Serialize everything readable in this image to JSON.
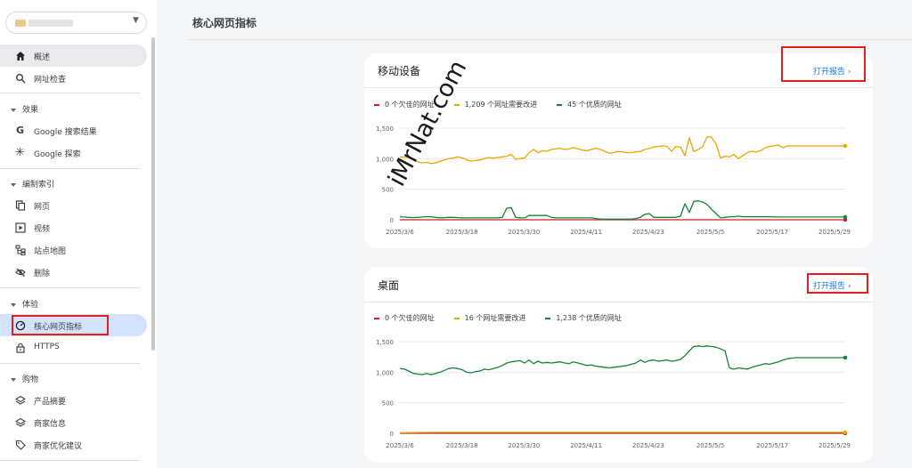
{
  "page_title": "核心网页指标",
  "sidebar": {
    "nav": [
      {
        "key": "overview",
        "label": "概述",
        "icon": "home-icon"
      },
      {
        "key": "url-inspection",
        "label": "网址检查",
        "icon": "search-icon"
      }
    ],
    "sections": [
      {
        "key": "performance",
        "label": "效果",
        "items": [
          {
            "key": "google-search",
            "label": "Google 搜索结果",
            "icon": "google-g-icon"
          },
          {
            "key": "google-discover",
            "label": "Google 探索",
            "icon": "asterisk-icon"
          }
        ]
      },
      {
        "key": "indexing",
        "label": "编制索引",
        "items": [
          {
            "key": "pages",
            "label": "网页",
            "icon": "pages-icon"
          },
          {
            "key": "videos",
            "label": "视频",
            "icon": "video-icon"
          },
          {
            "key": "sitemaps",
            "label": "站点地图",
            "icon": "sitemap-icon"
          },
          {
            "key": "removals",
            "label": "删除",
            "icon": "eye-off-icon"
          }
        ]
      },
      {
        "key": "experience",
        "label": "体验",
        "items": [
          {
            "key": "core-web-vitals",
            "label": "核心网页指标",
            "icon": "speedometer-icon"
          },
          {
            "key": "https",
            "label": "HTTPS",
            "icon": "lock-icon"
          }
        ]
      },
      {
        "key": "shopping",
        "label": "购物",
        "items": [
          {
            "key": "product-snippets",
            "label": "产品摘要",
            "icon": "layers-icon"
          },
          {
            "key": "merchant-listings",
            "label": "商家信息",
            "icon": "layers-icon"
          },
          {
            "key": "merchant-opportunities",
            "label": "商家优化建议",
            "icon": "tag-icon"
          }
        ]
      }
    ]
  },
  "mobile": {
    "title": "移动设备",
    "open_report": "打开报告",
    "legend": [
      {
        "label": "0 个欠佳的网址",
        "color": "#c5221f"
      },
      {
        "label": "1,209 个网址需要改进",
        "color": "#e8a600"
      },
      {
        "label": "45 个优质的网址",
        "color": "#188038"
      }
    ]
  },
  "desktop": {
    "title": "桌面",
    "open_report": "打开报告",
    "legend": [
      {
        "label": "0 个欠佳的网址",
        "color": "#c5221f"
      },
      {
        "label": "16 个网址需要改进",
        "color": "#e8a600"
      },
      {
        "label": "1,238 个优质的网址",
        "color": "#188038"
      }
    ]
  },
  "watermark": "iMrNat.com",
  "chart_data": [
    {
      "type": "line",
      "title": "移动设备",
      "x": [
        "2025/3/6",
        "2025/3/18",
        "2025/3/30",
        "2025/4/11",
        "2025/4/23",
        "2025/5/5",
        "2025/5/17",
        "2025/5/29"
      ],
      "yticks": [
        0,
        500,
        1000,
        1500
      ],
      "ylim": [
        0,
        1500
      ],
      "legend_position": "top-left",
      "grid": true,
      "series": [
        {
          "name": "0 个欠佳的网址",
          "color": "#c5221f",
          "values": [
            0,
            0,
            0,
            0,
            0,
            0,
            0,
            0,
            0,
            0,
            0,
            0,
            0,
            0,
            0,
            0,
            0,
            0,
            0,
            0,
            0,
            0,
            0,
            0,
            0,
            0,
            0,
            0,
            0,
            0,
            0,
            0,
            0,
            0,
            0,
            0,
            0,
            0,
            0,
            0,
            0,
            0,
            0,
            0,
            0,
            0,
            0,
            0,
            0,
            0,
            0,
            0,
            0,
            0,
            0,
            0,
            0,
            0,
            0,
            0,
            0,
            0,
            0,
            0,
            0,
            0,
            0,
            0,
            0,
            0,
            0,
            0,
            0,
            0,
            0,
            0,
            0,
            0,
            0,
            0,
            0,
            0,
            0,
            0,
            0,
            0,
            0,
            0,
            0,
            0,
            0,
            0,
            0,
            0,
            0,
            0,
            0,
            0,
            0,
            0,
            0
          ]
        },
        {
          "name": "1,209 个网址需要改进",
          "color": "#e8a600",
          "values": [
            1030,
            1025,
            1020,
            1000,
            950,
            930,
            940,
            920,
            930,
            960,
            980,
            1000,
            1010,
            1030,
            1010,
            980,
            960,
            970,
            980,
            1000,
            1020,
            1010,
            1020,
            1030,
            1040,
            1070,
            990,
            1000,
            1010,
            1100,
            1150,
            1100,
            1130,
            1120,
            1150,
            1160,
            1170,
            1150,
            1160,
            1180,
            1160,
            1140,
            1130,
            1150,
            1170,
            1150,
            1120,
            1090,
            1100,
            1120,
            1110,
            1100,
            1100,
            1110,
            1120,
            1150,
            1170,
            1190,
            1200,
            1210,
            1200,
            1120,
            1200,
            1190,
            1050,
            1340,
            1120,
            1150,
            1200,
            1360,
            1350,
            1240,
            1010,
            1040,
            1030,
            1070,
            1000,
            1050,
            1100,
            1120,
            1110,
            1130,
            1180,
            1200,
            1210,
            1220,
            1180,
            1209,
            1209,
            1209,
            1209,
            1209,
            1209,
            1209,
            1209,
            1209,
            1209,
            1209,
            1209,
            1209,
            1209
          ]
        },
        {
          "name": "45 个优质的网址",
          "color": "#188038",
          "values": [
            50,
            45,
            40,
            35,
            40,
            45,
            50,
            50,
            40,
            30,
            35,
            40,
            40,
            35,
            30,
            30,
            30,
            30,
            30,
            30,
            30,
            30,
            30,
            40,
            190,
            200,
            40,
            30,
            30,
            70,
            70,
            70,
            70,
            70,
            40,
            30,
            30,
            30,
            30,
            30,
            30,
            30,
            30,
            30,
            20,
            10,
            10,
            10,
            10,
            10,
            10,
            10,
            10,
            20,
            40,
            90,
            100,
            40,
            40,
            40,
            40,
            40,
            40,
            60,
            260,
            120,
            300,
            310,
            290,
            250,
            170,
            100,
            30,
            40,
            50,
            50,
            60,
            50,
            50,
            50,
            50,
            50,
            50,
            50,
            45,
            45,
            45,
            45,
            45,
            45,
            45,
            45,
            45,
            45,
            45,
            45,
            45,
            45,
            45,
            45,
            45
          ]
        }
      ]
    },
    {
      "type": "line",
      "title": "桌面",
      "x": [
        "2025/3/6",
        "2025/3/18",
        "2025/3/30",
        "2025/4/11",
        "2025/4/23",
        "2025/5/5",
        "2025/5/17",
        "2025/5/29"
      ],
      "yticks": [
        0,
        500,
        1000,
        1500
      ],
      "ylim": [
        0,
        1500
      ],
      "legend_position": "top-left",
      "grid": true,
      "series": [
        {
          "name": "0 个欠佳的网址",
          "color": "#c5221f",
          "values": [
            0,
            0,
            0,
            0,
            0,
            0,
            0,
            0,
            0,
            0,
            0,
            0,
            0,
            0,
            0,
            0,
            0,
            0,
            0,
            0,
            0,
            0,
            0,
            0,
            0,
            0,
            0,
            0,
            0,
            0,
            0,
            0,
            0,
            0,
            0,
            0,
            0,
            0,
            0,
            0,
            0,
            0,
            0,
            0,
            0,
            0,
            0,
            0,
            0,
            0,
            0,
            0,
            0,
            0,
            0,
            0,
            0,
            0,
            0,
            0,
            0,
            0,
            0,
            0,
            0,
            0,
            0,
            0,
            0,
            0,
            0,
            0,
            0,
            0,
            0,
            0,
            0,
            0,
            0,
            0,
            0,
            0,
            0,
            0,
            0,
            0,
            0,
            0,
            0,
            0,
            0,
            0,
            0,
            0,
            0,
            0,
            0,
            0,
            0,
            0,
            0
          ]
        },
        {
          "name": "16 个网址需要改进",
          "color": "#e8a600",
          "values": [
            10,
            10,
            12,
            12,
            15,
            15,
            15,
            16,
            16,
            16,
            16,
            16,
            16,
            16,
            16,
            16,
            16,
            16,
            16,
            16,
            16,
            16,
            16,
            16,
            16,
            16,
            16,
            16,
            16,
            16,
            16,
            16,
            16,
            16,
            16,
            16,
            16,
            16,
            16,
            16,
            16,
            16,
            16,
            16,
            16,
            16,
            16,
            16,
            16,
            16,
            16,
            16,
            16,
            16,
            16,
            16,
            16,
            16,
            16,
            16,
            16,
            16,
            16,
            16,
            16,
            16,
            16,
            16,
            16,
            16,
            16,
            16,
            16,
            16,
            16,
            16,
            16,
            16,
            16,
            16,
            16,
            16,
            16,
            16,
            16,
            16,
            16,
            16,
            16,
            16,
            16,
            16,
            16,
            16,
            16,
            16,
            16,
            16,
            16,
            16,
            16
          ]
        },
        {
          "name": "1,238 个优质的网址",
          "color": "#188038",
          "values": [
            1060,
            1050,
            1020,
            980,
            970,
            960,
            980,
            960,
            980,
            1000,
            1030,
            1060,
            1070,
            1060,
            1040,
            1000,
            990,
            1010,
            1020,
            1050,
            1040,
            1060,
            1080,
            1110,
            1150,
            1170,
            1180,
            1190,
            1150,
            1200,
            1140,
            1180,
            1150,
            1160,
            1150,
            1160,
            1170,
            1150,
            1140,
            1170,
            1150,
            1130,
            1110,
            1120,
            1100,
            1090,
            1080,
            1070,
            1080,
            1090,
            1100,
            1110,
            1130,
            1150,
            1200,
            1160,
            1190,
            1200,
            1180,
            1190,
            1200,
            1180,
            1190,
            1210,
            1270,
            1350,
            1420,
            1430,
            1420,
            1430,
            1420,
            1410,
            1380,
            1350,
            1070,
            1050,
            1070,
            1060,
            1050,
            1080,
            1100,
            1120,
            1140,
            1130,
            1150,
            1170,
            1200,
            1220,
            1230,
            1238,
            1238,
            1238,
            1238,
            1238,
            1238,
            1238,
            1238,
            1238,
            1238,
            1238,
            1238
          ]
        }
      ]
    }
  ]
}
